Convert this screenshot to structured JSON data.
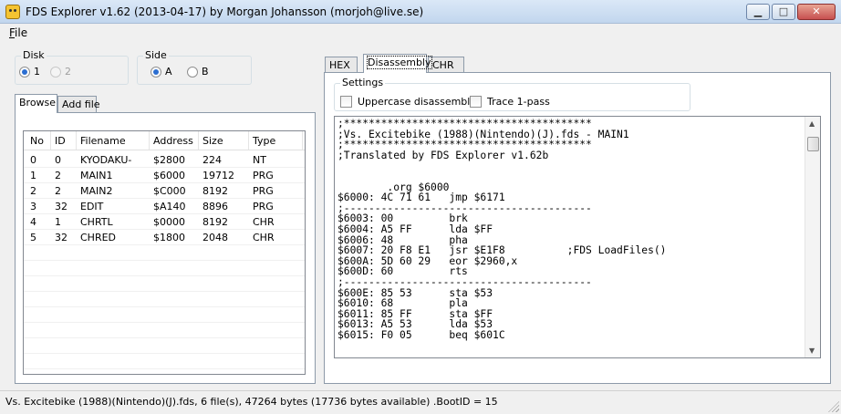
{
  "window": {
    "title": "FDS Explorer v1.62 (2013-04-17) by Morgan Johansson (morjoh@live.se)",
    "min_glyph": "▁",
    "max_glyph": "□",
    "close_glyph": "✕"
  },
  "menu": {
    "file": "File"
  },
  "disk_group": {
    "label": "Disk",
    "options": [
      "1",
      "2"
    ],
    "selected": "1",
    "disabled": [
      "2"
    ]
  },
  "side_group": {
    "label": "Side",
    "options": [
      "A",
      "B"
    ],
    "selected": "A"
  },
  "left_tabs": {
    "browse": "Browse",
    "add_file": "Add file"
  },
  "file_list": {
    "columns": [
      "No",
      "ID",
      "Filename",
      "Address",
      "Size",
      "Type"
    ],
    "rows": [
      [
        "0",
        "0",
        "KYODAKU-",
        "$2800",
        "224",
        "NT"
      ],
      [
        "1",
        "2",
        "MAIN1",
        "$6000",
        "19712",
        "PRG"
      ],
      [
        "2",
        "2",
        "MAIN2",
        "$C000",
        "8192",
        "PRG"
      ],
      [
        "3",
        "32",
        "EDIT",
        "$A140",
        "8896",
        "PRG"
      ],
      [
        "4",
        "1",
        "CHRTL",
        "$0000",
        "8192",
        "CHR"
      ],
      [
        "5",
        "32",
        "CHRED",
        "$1800",
        "2048",
        "CHR"
      ]
    ]
  },
  "right_tabs": {
    "hex": "HEX",
    "disassembly": "Disassembly",
    "chr": "CHR"
  },
  "settings": {
    "label": "Settings",
    "uppercase": "Uppercase disassembly",
    "trace": "Trace 1-pass"
  },
  "disassembly": {
    "lines": [
      ";****************************************",
      ";Vs. Excitebike (1988)(Nintendo)(J).fds - MAIN1",
      ";****************************************",
      ";Translated by FDS Explorer v1.62b",
      "",
      "",
      "        .org $6000",
      "$6000: 4C 71 61   jmp $6171",
      ";----------------------------------------",
      "$6003: 00         brk",
      "$6004: A5 FF      lda $FF",
      "$6006: 48         pha",
      "$6007: 20 F8 E1   jsr $E1F8          ;FDS LoadFiles()",
      "$600A: 5D 60 29   eor $2960,x",
      "$600D: 60         rts",
      ";----------------------------------------",
      "$600E: 85 53      sta $53",
      "$6010: 68         pla",
      "$6011: 85 FF      sta $FF",
      "$6013: A5 53      lda $53",
      "$6015: F0 05      beq $601C"
    ]
  },
  "status": {
    "text": "Vs. Excitebike (1988)(Nintendo)(J).fds, 6 file(s), 47264 bytes (17736 bytes available) .BootID = 15"
  }
}
